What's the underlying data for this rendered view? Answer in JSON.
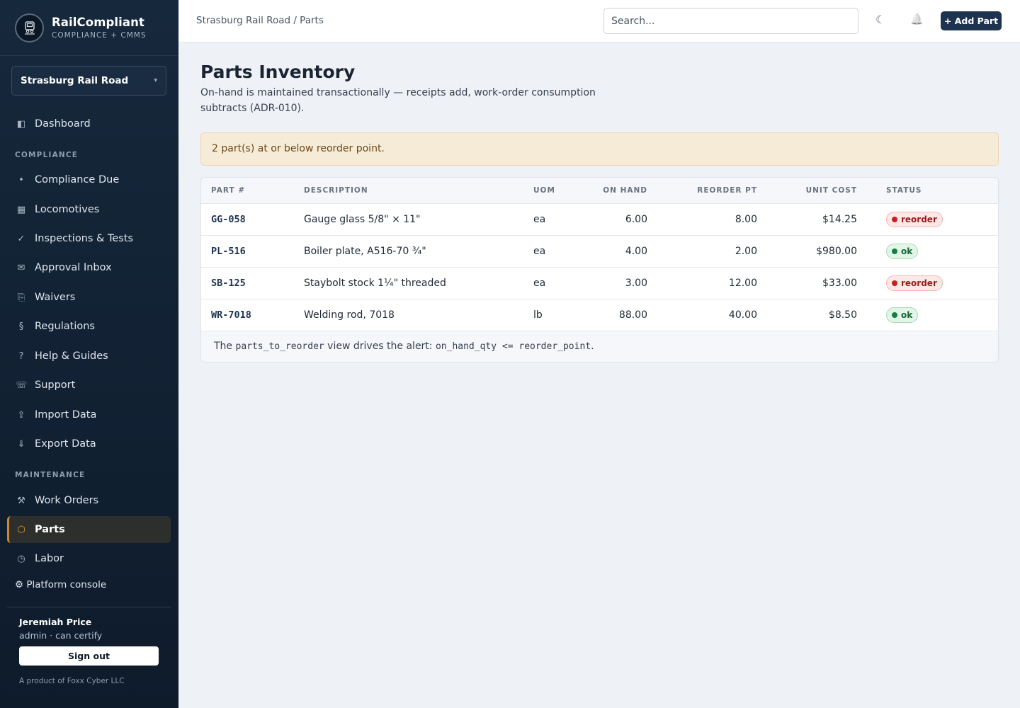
{
  "brand": {
    "name": "RailCompliant",
    "subtitle": "COMPLIANCE + CMMS",
    "logo_icon": "locomotive-emblem-icon"
  },
  "org": {
    "name": "Strasburg Rail Road",
    "caret": "▾"
  },
  "nav": {
    "dashboard": {
      "icon": "◧",
      "label": "Dashboard"
    },
    "compliance_section": "COMPLIANCE",
    "compliance_items": [
      {
        "icon": "•",
        "label": "Compliance Due"
      },
      {
        "icon": "▦",
        "label": "Locomotives"
      },
      {
        "icon": "✓",
        "label": "Inspections & Tests"
      },
      {
        "icon": "✉",
        "label": "Approval Inbox"
      },
      {
        "icon": "⎘",
        "label": "Waivers"
      },
      {
        "icon": "§",
        "label": "Regulations"
      },
      {
        "icon": "?",
        "label": "Help & Guides"
      },
      {
        "icon": "☏",
        "label": "Support"
      },
      {
        "icon": "⇪",
        "label": "Import Data"
      },
      {
        "icon": "⇓",
        "label": "Export Data"
      }
    ],
    "maintenance_section": "MAINTENANCE",
    "maintenance_items": [
      {
        "icon": "⚒",
        "label": "Work Orders"
      },
      {
        "icon": "⬡",
        "label": "Parts"
      },
      {
        "icon": "◷",
        "label": "Labor"
      }
    ],
    "platform_console": "⚙ Platform console"
  },
  "user": {
    "name": "Jeremiah Price",
    "role": "admin · can certify",
    "signout_label": "Sign out",
    "product_note": "A product of Foxx Cyber LLC"
  },
  "topbar": {
    "breadcrumb": "Strasburg Rail Road / Parts",
    "search_placeholder": "Search...",
    "theme_icon": "☾",
    "bell_icon": "🔔",
    "add_label": "+ Add Part"
  },
  "page": {
    "title": "Parts Inventory",
    "description": "On-hand is maintained transactionally — receipts add, work-order consumption subtracts (ADR-010).",
    "alert": "2 part(s) at or below reorder point."
  },
  "table": {
    "columns": [
      "PART #",
      "DESCRIPTION",
      "UOM",
      "ON HAND",
      "REORDER PT",
      "UNIT COST",
      "STATUS"
    ],
    "rows": [
      {
        "part": "GG-058",
        "description": "Gauge glass 5/8\" × 11\"",
        "uom": "ea",
        "on_hand": "6.00",
        "reorder_pt": "8.00",
        "unit_cost": "$14.25",
        "status": "reorder"
      },
      {
        "part": "PL-516",
        "description": "Boiler plate, A516-70 ¾\"",
        "uom": "ea",
        "on_hand": "4.00",
        "reorder_pt": "2.00",
        "unit_cost": "$980.00",
        "status": "ok"
      },
      {
        "part": "SB-125",
        "description": "Staybolt stock 1¼\" threaded",
        "uom": "ea",
        "on_hand": "3.00",
        "reorder_pt": "12.00",
        "unit_cost": "$33.00",
        "status": "reorder"
      },
      {
        "part": "WR-7018",
        "description": "Welding rod, 7018",
        "uom": "lb",
        "on_hand": "88.00",
        "reorder_pt": "40.00",
        "unit_cost": "$8.50",
        "status": "ok"
      }
    ],
    "footer": {
      "pre": "The ",
      "view_name": "parts_to_reorder",
      "mid": " view drives the alert: ",
      "condition": "on_hand_qty <= reorder_point",
      "post": "."
    }
  },
  "colors": {
    "sidebar_bg": "#16283c",
    "accent": "#c9892d",
    "primary_button": "#1e3350",
    "reorder": "#c81e1e",
    "ok": "#15803d"
  }
}
